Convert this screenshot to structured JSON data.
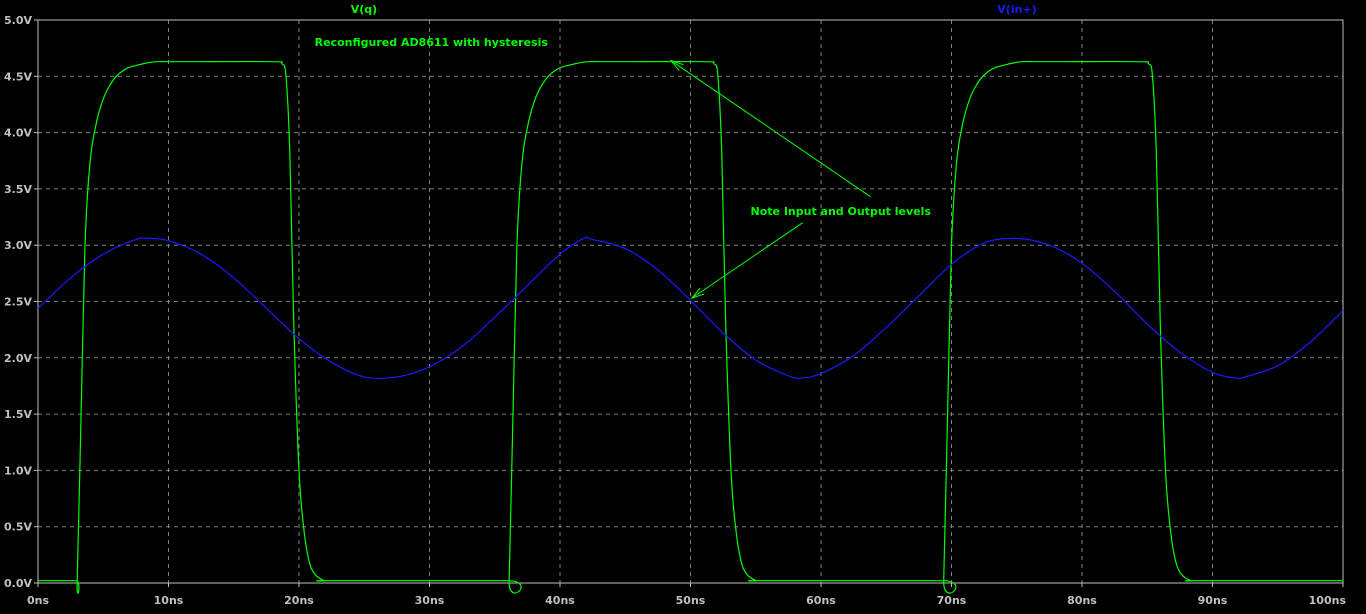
{
  "colors": {
    "background": "#000000",
    "frame": "#c0c0c0",
    "grid": "#808080",
    "axis_text": "#c0c0c0",
    "v_q": "#00ff00",
    "v_in": "#1a1aff",
    "annotation": "#00ff00"
  },
  "chart_data": {
    "type": "line",
    "title": "",
    "xlabel": "",
    "ylabel": "",
    "xlim": [
      0,
      100
    ],
    "ylim": [
      0,
      5
    ],
    "grid": true,
    "x_ticks": [
      0,
      10,
      20,
      30,
      40,
      50,
      60,
      70,
      80,
      90,
      100
    ],
    "x_tick_labels": [
      "0ns",
      "10ns",
      "20ns",
      "30ns",
      "40ns",
      "50ns",
      "60ns",
      "70ns",
      "80ns",
      "90ns",
      "100ns"
    ],
    "y_ticks": [
      0,
      0.5,
      1,
      1.5,
      2,
      2.5,
      3,
      3.5,
      4,
      4.5,
      5
    ],
    "y_tick_labels": [
      "0.0V",
      "0.5V",
      "1.0V",
      "1.5V",
      "2.0V",
      "2.5V",
      "3.0V",
      "3.5V",
      "4.0V",
      "4.5V",
      "5.0V"
    ],
    "series": [
      {
        "name": "V(q)",
        "color": "#00ff00",
        "x": [
          0,
          2.9,
          3.0,
          3.3,
          3.6,
          4.0,
          4.5,
          5.0,
          5.5,
          6.0,
          6.5,
          7.0,
          8.0,
          9.0,
          10.0,
          12.0,
          18.0,
          18.7,
          19.0,
          19.3,
          19.6,
          20.0,
          20.4,
          20.8,
          21.2,
          21.6,
          22.0,
          22.5,
          36.0,
          36.1,
          36.4,
          36.7,
          37.1,
          37.6,
          38.1,
          38.6,
          39.1,
          39.6,
          40.1,
          41.1,
          42.1,
          43.1,
          45.1,
          51.1,
          51.8,
          52.1,
          52.4,
          52.7,
          53.1,
          53.5,
          53.9,
          54.3,
          54.7,
          55.1,
          55.6,
          69.3,
          69.4,
          69.7,
          70.0,
          70.4,
          70.9,
          71.4,
          71.9,
          72.4,
          72.9,
          73.4,
          74.4,
          75.4,
          76.4,
          78.4,
          84.4,
          85.1,
          85.4,
          85.7,
          86.0,
          86.4,
          86.8,
          87.2,
          87.6,
          88.0,
          88.4,
          88.9,
          100
        ],
        "values": [
          0.02,
          0.02,
          0.02,
          1.5,
          3.0,
          3.75,
          4.1,
          4.3,
          4.42,
          4.5,
          4.55,
          4.58,
          4.61,
          4.63,
          4.63,
          4.63,
          4.63,
          4.61,
          4.5,
          3.8,
          2.3,
          1.0,
          0.45,
          0.18,
          0.08,
          0.04,
          0.02,
          0.02,
          0.02,
          0.02,
          1.5,
          3.0,
          3.75,
          4.1,
          4.3,
          4.42,
          4.5,
          4.55,
          4.58,
          4.61,
          4.63,
          4.63,
          4.63,
          4.63,
          4.61,
          4.5,
          3.8,
          2.3,
          1.0,
          0.45,
          0.18,
          0.08,
          0.04,
          0.02,
          0.02,
          0.02,
          0.02,
          1.5,
          3.0,
          3.75,
          4.1,
          4.3,
          4.42,
          4.5,
          4.55,
          4.58,
          4.61,
          4.63,
          4.63,
          4.63,
          4.63,
          4.61,
          4.5,
          3.8,
          2.3,
          1.0,
          0.45,
          0.18,
          0.08,
          0.04,
          0.02,
          0.02,
          0.02
        ]
      },
      {
        "name": "V(in+)",
        "color": "#1a1aff",
        "x": [
          0,
          2.5,
          5,
          7.5,
          8.5,
          10,
          12.5,
          15,
          17.5,
          20,
          22.5,
          25,
          27.5,
          30,
          32.5,
          35,
          37.5,
          40,
          41.8,
          42.5,
          45,
          47.5,
          50,
          52.5,
          55,
          57.5,
          58.5,
          60,
          62.5,
          65,
          67.5,
          70,
          72.5,
          75,
          77.5,
          80,
          82.5,
          85,
          87.5,
          90,
          91.8,
          92.5,
          95,
          97.5,
          100
        ],
        "values": [
          2.44,
          2.71,
          2.92,
          3.05,
          3.06,
          3.04,
          2.92,
          2.71,
          2.44,
          2.17,
          1.96,
          1.83,
          1.83,
          1.92,
          2.1,
          2.36,
          2.64,
          2.92,
          3.06,
          3.05,
          2.97,
          2.78,
          2.51,
          2.22,
          1.98,
          1.84,
          1.82,
          1.86,
          2.02,
          2.27,
          2.55,
          2.83,
          3.02,
          3.06,
          3.0,
          2.84,
          2.59,
          2.3,
          2.05,
          1.87,
          1.82,
          1.83,
          1.93,
          2.14,
          2.42
        ]
      }
    ],
    "annotations": [
      {
        "text": "Reconfigured AD8611 with hysteresis",
        "x": 21.2,
        "y": 4.77
      },
      {
        "text": "Note Input and Output levels",
        "x": 54.6,
        "y": 3.27
      }
    ],
    "arrows": [
      {
        "from": [
          63.8,
          3.43
        ],
        "to": [
          48.5,
          4.64
        ]
      },
      {
        "from": [
          58.6,
          3.2
        ],
        "to": [
          50.1,
          2.53
        ]
      }
    ]
  }
}
